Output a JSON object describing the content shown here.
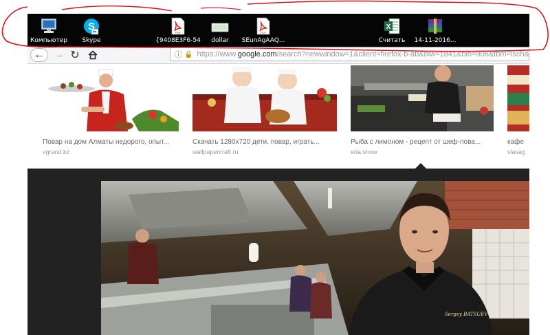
{
  "desktop": {
    "icons": [
      {
        "label": "Компьютер",
        "icon": "computer-icon"
      },
      {
        "label": "Skype",
        "icon": "skype-icon"
      },
      {
        "label": "{9408E3F6-54",
        "icon": "pdf-file-icon"
      },
      {
        "label": "dollar",
        "icon": "image-file-icon"
      },
      {
        "label": "SEunAgAAQ...",
        "icon": "pdf-file-icon"
      },
      {
        "label": "Считать",
        "icon": "excel-file-icon"
      },
      {
        "label": "14-11-2016...",
        "icon": "winrar-archive-icon"
      }
    ]
  },
  "browser": {
    "url_prefix": "https://www.",
    "url_domain": "google.com",
    "url_rest": "/search?newwindow=1&client=firefox-b-ab&biw=1841&bih=906&tbm=isch&"
  },
  "results": [
    {
      "caption": "Повар на дом Алматы недорого, опыт...",
      "source": "vgrand.kz"
    },
    {
      "caption": "Скачать 1280x720 дети, повар, играть...",
      "source": "wallpapercraft.ru"
    },
    {
      "caption": "Рыба с лимоном - рецепт от шеф-пова...",
      "source": "eda.show"
    },
    {
      "caption": "кафе",
      "source": "slavag"
    }
  ],
  "preview": {
    "chef_badge": "Sergey BATSUEV"
  },
  "colors": {
    "scribble_red": "#e0101a",
    "preview_bg": "#222222",
    "strip_bg": "#050505"
  }
}
